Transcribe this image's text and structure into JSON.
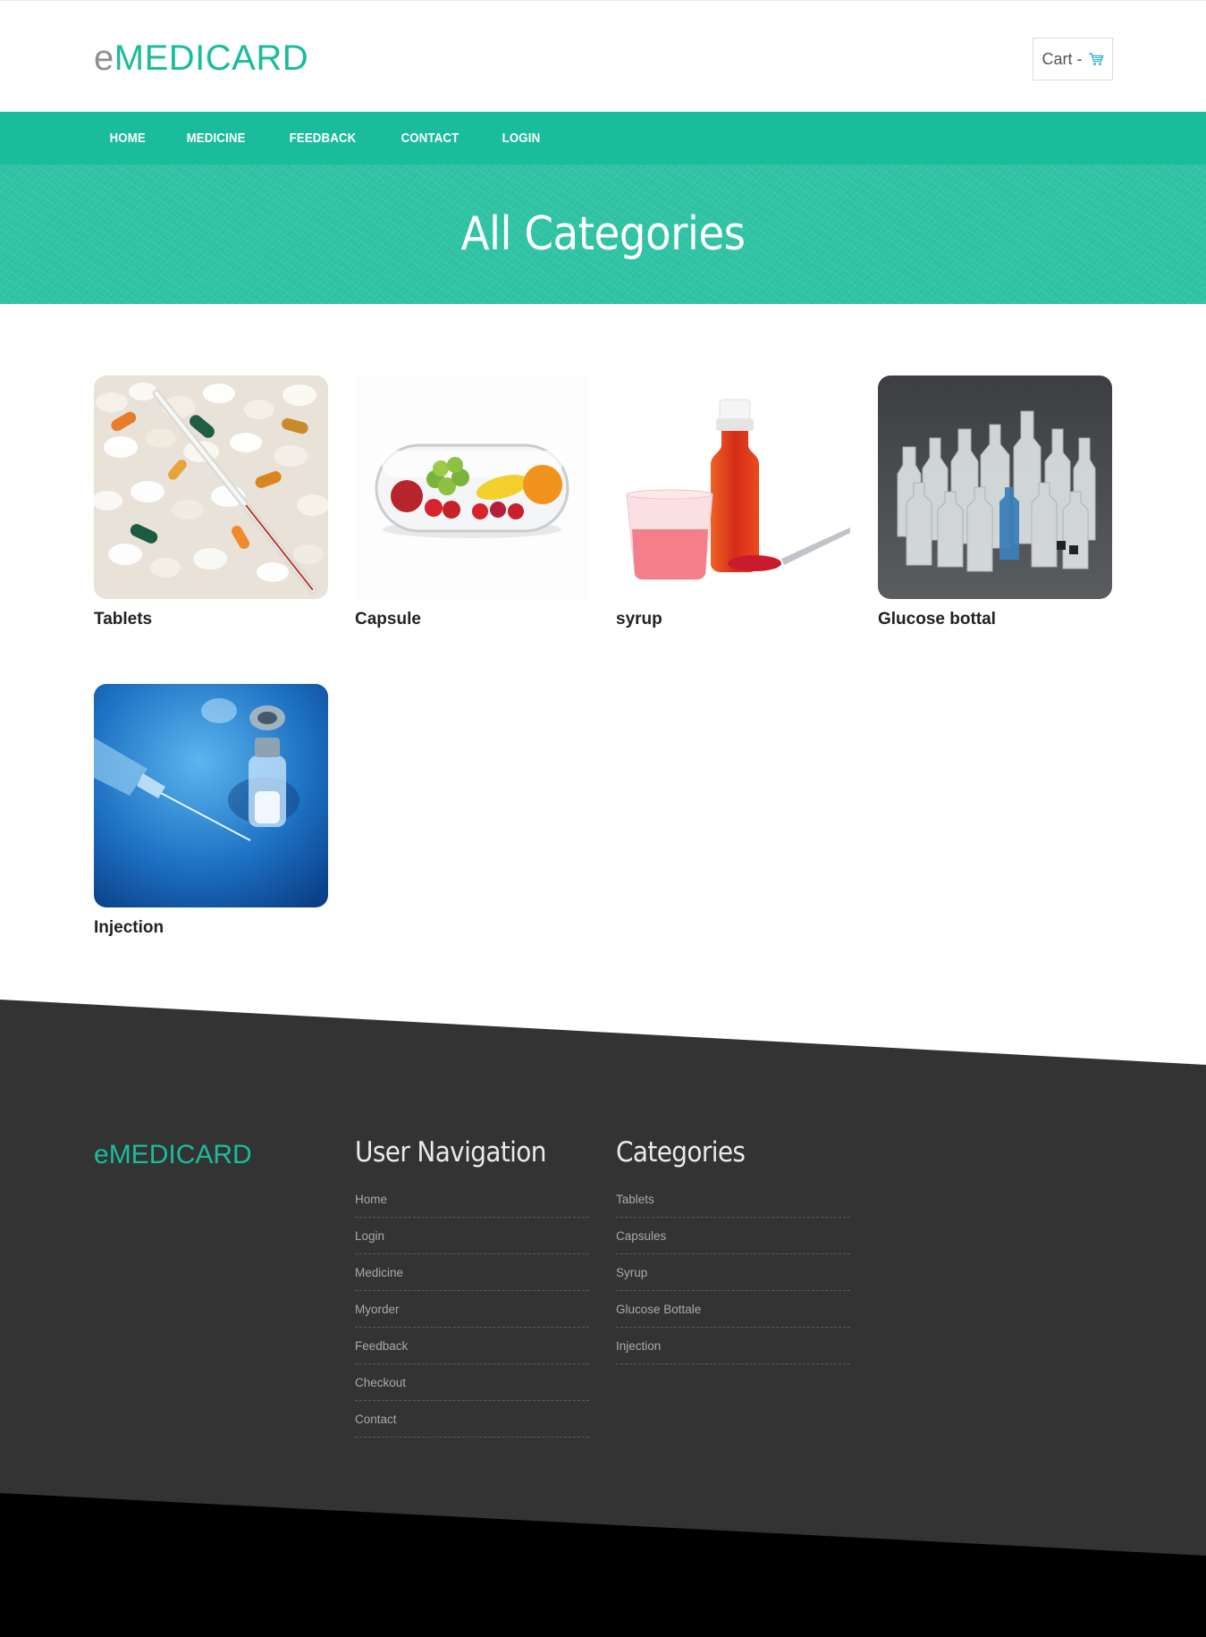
{
  "header": {
    "logo_prefix": "e",
    "logo_main": "MEDICARD",
    "cart_label": "Cart -",
    "cart_icon": "shopping-cart-icon"
  },
  "nav": {
    "items": [
      "HOME",
      "MEDICINE",
      "FEEDBACK",
      "CONTACT",
      "LOGIN"
    ]
  },
  "banner": {
    "title": "All Categories"
  },
  "categories": [
    {
      "label": "Tablets",
      "image": "pills-and-thermometer"
    },
    {
      "label": "Capsule",
      "image": "capsule-with-fruit"
    },
    {
      "label": "syrup",
      "image": "syrup-bottle-cup-spoon"
    },
    {
      "label": "Glucose bottal",
      "image": "plastic-bottles"
    },
    {
      "label": "Injection",
      "image": "syringe-and-vial"
    }
  ],
  "footer": {
    "logo_prefix": "e",
    "logo_main": "MEDICARD",
    "user_nav": {
      "title": "User Navigation",
      "items": [
        "Home",
        "Login",
        "Medicine",
        "Myorder",
        "Feedback",
        "Checkout",
        "Contact"
      ]
    },
    "categories": {
      "title": "Categories",
      "items": [
        "Tablets",
        "Capsules",
        "Syrup",
        "Glucose Bottale",
        "Injection"
      ]
    }
  },
  "colors": {
    "accent": "#1abc9c",
    "footer_bg": "#333333",
    "bottom_bg": "#000000"
  }
}
